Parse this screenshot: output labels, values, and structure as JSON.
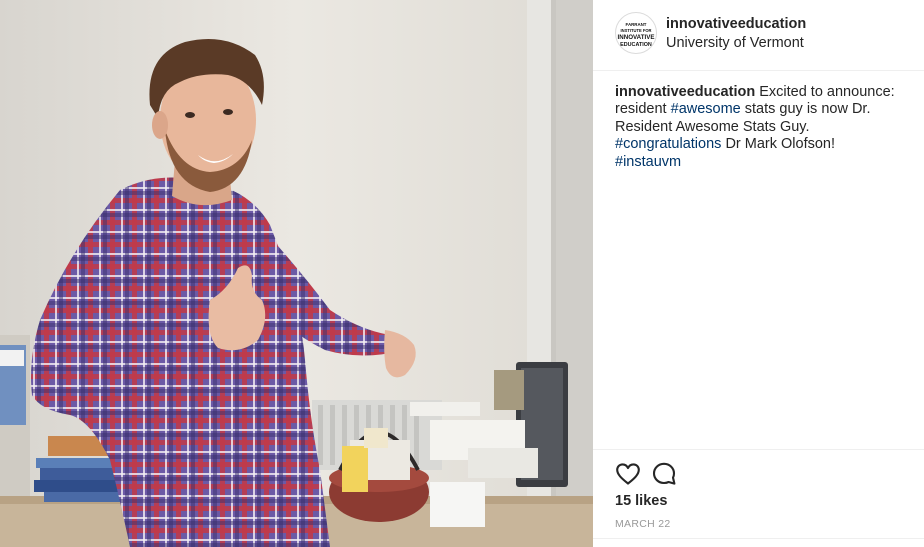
{
  "post": {
    "username": "innovativeeducation",
    "location": "University of Vermont",
    "avatar_text": [
      "FARRANT",
      "INSTITUTE FOR",
      "INNOVATIVE",
      "EDUCATION"
    ],
    "caption": {
      "username": "innovativeeducation",
      "text_1": " Excited to announce: resident ",
      "tag_1": "#awesome",
      "text_2": " stats guy is now Dr. Resident Awesome Stats Guy. ",
      "tag_2": "#congratulations",
      "text_3": " Dr Mark Olofson! ",
      "tag_3": "#instauvm"
    },
    "likes": "15 likes",
    "date": "MARCH 22"
  },
  "icons": {
    "like": "heart-outline-icon",
    "comment": "speech-bubble-icon"
  },
  "colors": {
    "text": "#262626",
    "hashtag": "#003569",
    "muted": "#999999",
    "divider": "#efefef",
    "shirt_purple": "#5b4a9a",
    "shirt_red": "#b2303c"
  }
}
